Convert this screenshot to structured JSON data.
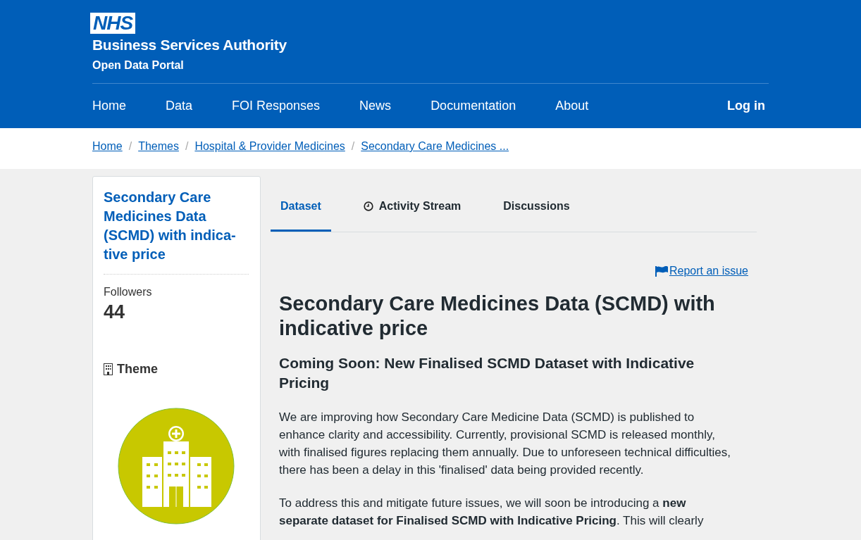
{
  "header": {
    "logo": "NHS",
    "org_name": "Business Services Authority",
    "portal_name": "Open Data Portal"
  },
  "nav": {
    "items": [
      {
        "label": "Home"
      },
      {
        "label": "Data"
      },
      {
        "label": "FOI Responses"
      },
      {
        "label": "News"
      },
      {
        "label": "Documentation"
      },
      {
        "label": "About"
      }
    ],
    "login": "Log in"
  },
  "breadcrumb": [
    {
      "label": "Home"
    },
    {
      "separator": "/",
      "label": "Themes"
    },
    {
      "separator": "/",
      "label": "Hospital & Provider Medicines"
    },
    {
      "separator": "/",
      "label": "Secondary Care Medicines ..."
    }
  ],
  "sidebar": {
    "title": "Secondary Care Medicines Data (SCMD) with indica-tive price",
    "followers_label": "Followers",
    "followers_count": "44",
    "theme_heading": "Theme"
  },
  "tabs": [
    {
      "label": "Dataset",
      "selected": true,
      "kind": "plain"
    },
    {
      "label": "Activity Stream",
      "selected": false,
      "kind": "timed"
    },
    {
      "label": "Discussions",
      "selected": false,
      "kind": "plain"
    }
  ],
  "report_link": "Report an issue",
  "title": "Secondary Care Medicines Data (SCMD) with indicative price",
  "subtitle": "Coming Soon: New Finalised SCMD Dataset with Indicative Pricing",
  "paragraphs": [
    "We are improving how Secondary Care Medicine Data (SCMD) is published to enhance clarity and accessibility. Currently, provisional SCMD is released monthly, with finalised figures replacing them annually. Due to unforeseen technical difficulties, there has been a delay in this 'finalised' data being provided recently.",
    "To address this and mitigate future issues, we will soon be introducing a **new separate dataset for Finalised SCMD with Indicative Pricing**. This will clearly"
  ]
}
